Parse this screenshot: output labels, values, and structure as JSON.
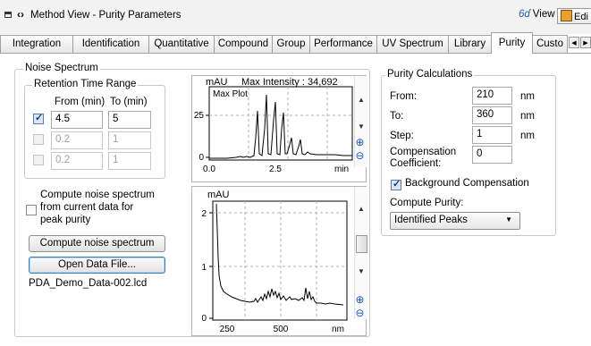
{
  "window": {
    "title": "Method View - Purity Parameters",
    "view_label": "View",
    "edit_label": "Edi"
  },
  "tabs": [
    {
      "label": "Integration"
    },
    {
      "label": "Identification"
    },
    {
      "label": "Quantitative"
    },
    {
      "label": "Compound"
    },
    {
      "label": "Group"
    },
    {
      "label": "Performance"
    },
    {
      "label": "UV Spectrum"
    },
    {
      "label": "Library"
    },
    {
      "label": "Purity",
      "active": true
    },
    {
      "label": "Custo"
    }
  ],
  "noise_spectrum": {
    "title": "Noise Spectrum",
    "retention": {
      "title": "Retention Time Range",
      "from_header": "From (min)",
      "to_header": "To (min)",
      "rows": [
        {
          "checked": true,
          "from": "4.5",
          "to": "5"
        },
        {
          "checked": false,
          "from": "0.2",
          "to": "1"
        },
        {
          "checked": false,
          "from": "0.2",
          "to": "1"
        }
      ]
    },
    "compute_current_label_1": "Compute noise spectrum",
    "compute_current_label_2": "from current data for",
    "compute_current_label_3": "peak purity",
    "compute_button": "Compute noise spectrum",
    "open_button": "Open Data File...",
    "file_name": "PDA_Demo_Data-002.lcd"
  },
  "max_plot": {
    "ylabel": "mAU",
    "intensity_text": "Max Intensity : 34,692",
    "inner_title": "Max Plot",
    "xunit": "min",
    "y_ticks": [
      "25",
      "0"
    ],
    "x_ticks": [
      "0.0",
      "2.5"
    ]
  },
  "spectrum_plot": {
    "ylabel": "mAU",
    "xunit": "nm",
    "y_ticks": [
      "2",
      "1",
      "0"
    ],
    "x_ticks": [
      "250",
      "500"
    ]
  },
  "purity": {
    "title": "Purity Calculations",
    "from_label": "From:",
    "from_value": "210",
    "from_unit": "nm",
    "to_label": "To:",
    "to_value": "360",
    "to_unit": "nm",
    "step_label": "Step:",
    "step_value": "1",
    "step_unit": "nm",
    "comp_label_1": "Compensation",
    "comp_label_2": "Coefficient:",
    "comp_value": "0",
    "background_label": "Background Compensation",
    "background_checked": true,
    "compute_purity_label": "Compute Purity:",
    "compute_purity_value": "Identified Peaks"
  },
  "colors": {
    "tab_border": "#a0a0a0",
    "accent_blue": "#1c58c0",
    "plot_line": "#000000"
  },
  "icons": [
    "window-icon",
    "nav-arrows-icon",
    "view-glasses-icon",
    "edit-icon",
    "zoom-in-icon",
    "zoom-out-icon",
    "scroll-up-icon",
    "scroll-down-icon"
  ]
}
